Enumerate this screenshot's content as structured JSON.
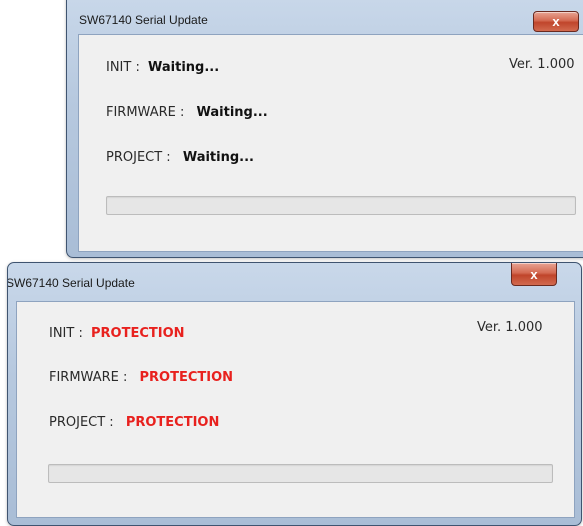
{
  "windows": [
    {
      "title": "SW67140 Serial Update",
      "close_label": "x",
      "version": "Ver. 1.000",
      "rows": [
        {
          "label": "INIT :",
          "value": "Waiting..."
        },
        {
          "label": "FIRMWARE :",
          "value": "Waiting..."
        },
        {
          "label": "PROJECT :",
          "value": "Waiting..."
        }
      ],
      "progress": 0,
      "value_color": "#111111"
    },
    {
      "title": "SW67140 Serial Update",
      "close_label": "x",
      "version": "Ver. 1.000",
      "rows": [
        {
          "label": "INIT :",
          "value": "PROTECTION"
        },
        {
          "label": "FIRMWARE :",
          "value": "PROTECTION"
        },
        {
          "label": "PROJECT :",
          "value": "PROTECTION"
        }
      ],
      "progress": 0,
      "value_color": "#e8211e"
    }
  ]
}
